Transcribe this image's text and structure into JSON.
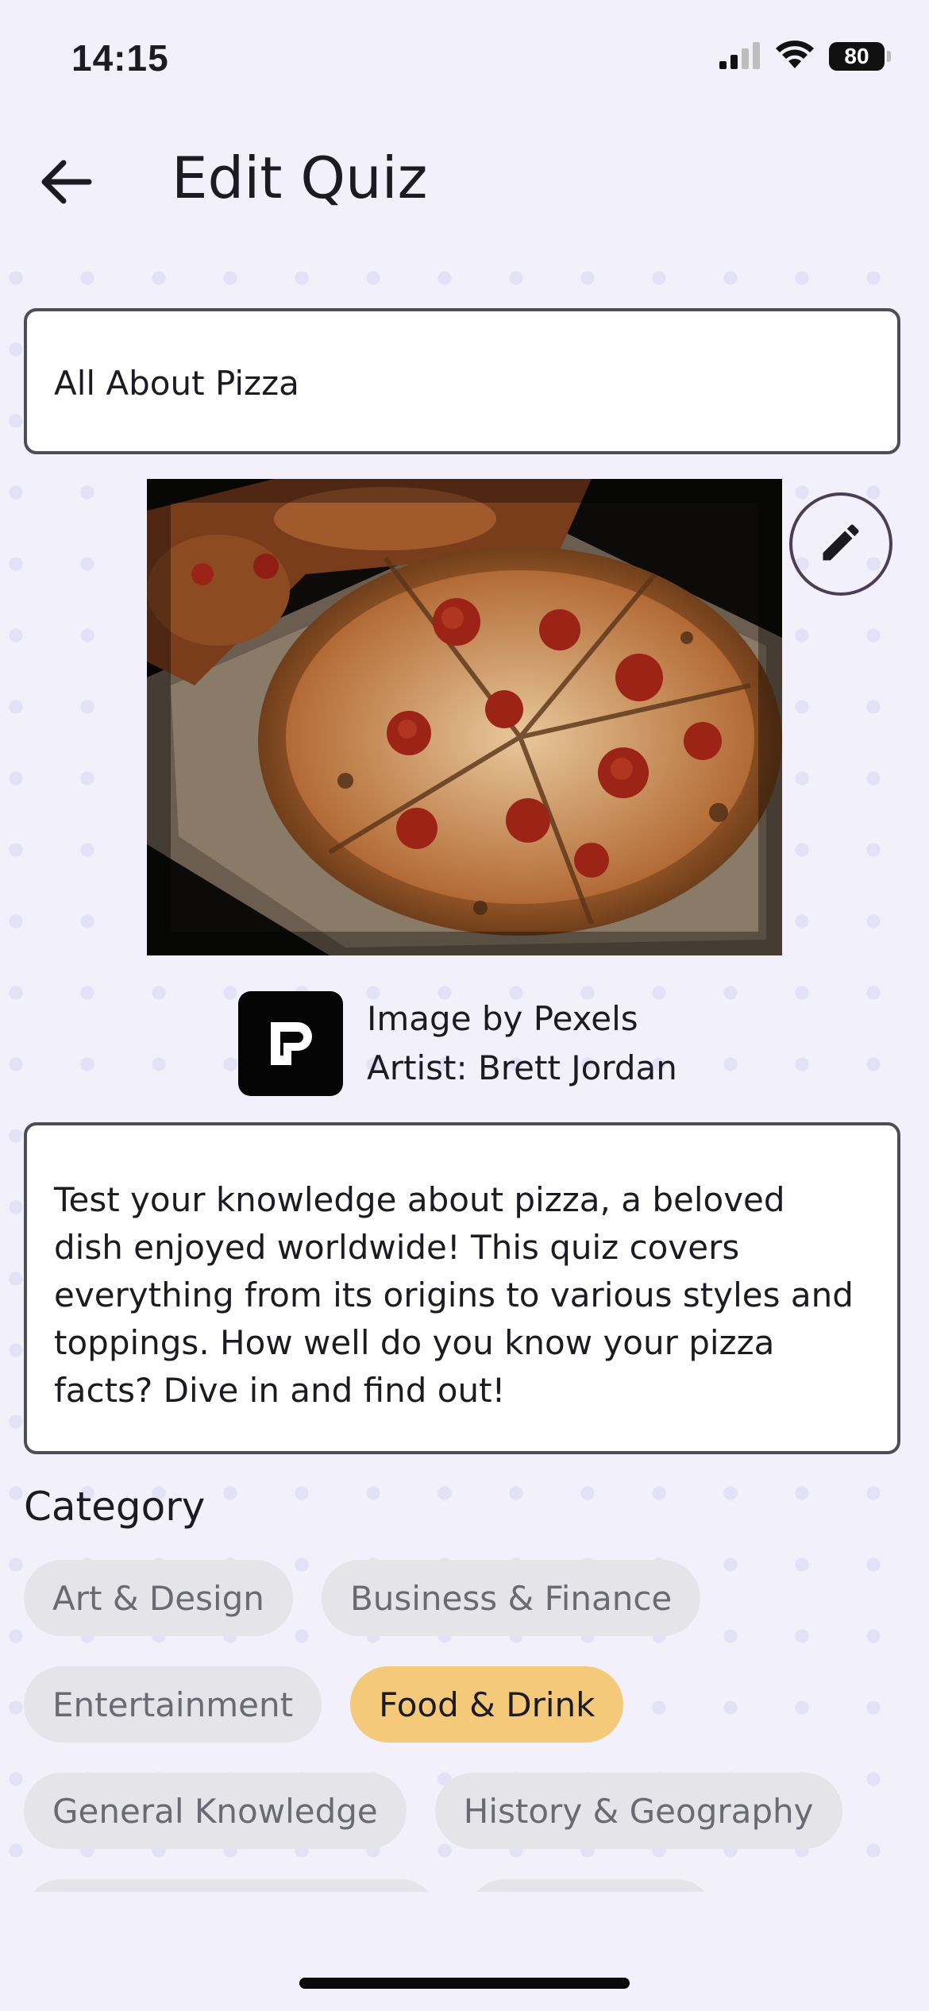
{
  "status_bar": {
    "time": "14:15",
    "battery": "80"
  },
  "header": {
    "title": "Edit Quiz",
    "back_icon": "arrow-left-icon"
  },
  "quiz": {
    "title_value": "All About Pizza",
    "image_edit_icon": "pencil-icon",
    "image_credit_line1": "Image by Pexels",
    "image_credit_line2": "Artist: Brett Jordan",
    "description_value": "Test your knowledge about pizza, a beloved dish enjoyed worldwide! This quiz covers everything from its origins to various styles and toppings. How well do you know your pizza facts? Dive in and find out!"
  },
  "category": {
    "label": "Category",
    "chips": [
      [
        "Art & Design",
        "Business & Finance"
      ],
      [
        "Entertainment",
        "Food & Drink"
      ],
      [
        "General Knowledge",
        "History & Geography"
      ]
    ],
    "selected": "Food & Drink"
  },
  "colors": {
    "background": "#f1f0fb",
    "selected_chip": "#f4c97a",
    "chip": "#e4e4e9",
    "field_border": "#4d4d55"
  }
}
